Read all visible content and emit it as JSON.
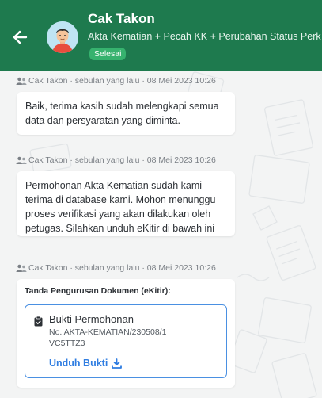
{
  "header": {
    "title": "Cak Takon",
    "subtitle": "Akta Kematian + Pecah KK + Perubahan Status Perk",
    "status": "Selesai",
    "colors": {
      "bar": "#1e7a4e",
      "badge": "#36b26e"
    }
  },
  "messages": [
    {
      "meta": "Cak Takon · sebulan yang lalu · 08 Mei 2023 10:26",
      "text": "Baik, terima kasih sudah melengkapi semua data dan persyaratan yang diminta."
    },
    {
      "meta": "Cak Takon · sebulan yang lalu · 08 Mei 2023 10:26",
      "text": "Permohonan Akta Kematian sudah kami terima di database kami. Mohon menunggu proses verifikasi yang akan dilakukan oleh petugas. Silahkan unduh eKitir di bawah ini"
    },
    {
      "meta": "Cak Takon · sebulan yang lalu · 08 Mei 2023 10:26",
      "card": {
        "title": "Tanda Pengurusan Dokumen (eKitir):",
        "doc_name": "Bukti Permohonan",
        "doc_number": "No. AKTA-KEMATIAN/230508/1VC5TTZ3",
        "download_label": "Unduh Bukti",
        "icon": "clipboard-icon",
        "accent": "#2f7de1"
      }
    }
  ]
}
